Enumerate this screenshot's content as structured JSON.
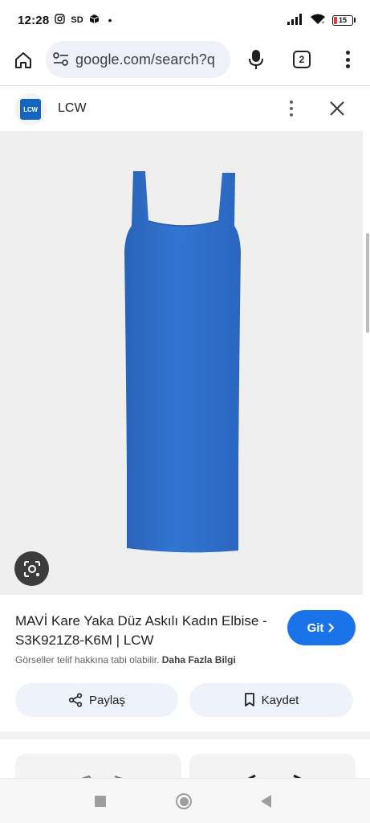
{
  "status_bar": {
    "time": "12:28",
    "sd_label": "SD",
    "battery_level": "15",
    "icons": [
      "instagram-icon",
      "sd-card-icon",
      "box-icon",
      "signal-icon",
      "wifi-icon",
      "battery-icon"
    ]
  },
  "browser": {
    "url": "google.com/search?q",
    "tab_count": "2",
    "icons": [
      "home-icon",
      "tune-icon",
      "mic-icon",
      "tabs-icon",
      "more-vert-icon"
    ]
  },
  "source": {
    "logo_text": "LCW",
    "name": "LCW",
    "icons": [
      "more-vert-icon",
      "close-icon"
    ]
  },
  "image": {
    "description_icon": "lens-icon",
    "dress_color": "#2f6fcb",
    "background_color": "#efefef"
  },
  "result": {
    "title": "MAVİ Kare Yaka Düz Askılı Kadın Elbise - S3K921Z8-K6M | LCW",
    "go_label": "Git",
    "copyright_text": "Görseller telif hakkına tabi olabilir.",
    "more_info_label": "Daha Fazla Bilgi"
  },
  "actions": {
    "share_label": "Paylaş",
    "save_label": "Kaydet"
  },
  "colors": {
    "accent": "#1a73e8",
    "pill": "#eef1f8",
    "action_button": "#edf2fb"
  }
}
